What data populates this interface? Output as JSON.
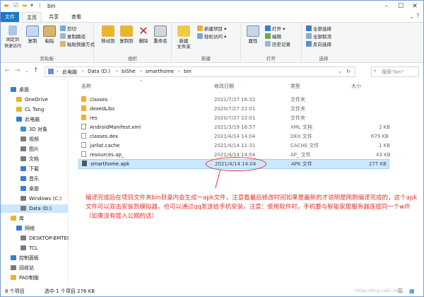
{
  "window": {
    "title": "bin"
  },
  "tabs": [
    "文件",
    "主页",
    "共享",
    "查看"
  ],
  "ribbon": {
    "clipboard": {
      "pin": "固定到\n快速访问",
      "copy": "复制",
      "paste": "粘贴",
      "cut": "剪切",
      "copy_path": "复制路径",
      "paste_shortcut": "粘贴快捷方式",
      "label": "剪贴板"
    },
    "organize": {
      "move_to": "移动到",
      "copy_to": "复制到",
      "delete": "删除",
      "rename": "重命名",
      "label": "组织"
    },
    "new": {
      "new_folder": "新建\n文件夹",
      "new_item": "新建项目",
      "easy_access": "轻松访问",
      "label": "新建"
    },
    "open": {
      "properties": "属性",
      "open": "打开",
      "edit": "编辑",
      "history": "历史记录",
      "label": "打开"
    },
    "select": {
      "select_all": "全部选择",
      "select_none": "全部取消",
      "invert": "反向选择",
      "label": "选择"
    }
  },
  "address": {
    "crumbs": [
      "此电脑",
      "Data (D:)",
      "biShe",
      "smarthome",
      "bin"
    ],
    "search_placeholder": "搜索\"bin\""
  },
  "nav": [
    {
      "label": "桌面",
      "color": "#3a7bd5"
    },
    {
      "label": "OneDrive",
      "color": "#e9b430"
    },
    {
      "label": "CL Tang",
      "color": "#e9b430"
    },
    {
      "label": "此电脑",
      "color": "#3a7bd5"
    },
    {
      "label": "3D 对象",
      "color": "#3a8fd5"
    },
    {
      "label": "视频",
      "color": "#7a7a7a"
    },
    {
      "label": "图片",
      "color": "#7a7a7a"
    },
    {
      "label": "文档",
      "color": "#7a7a7a"
    },
    {
      "label": "下载",
      "color": "#3a7bd5"
    },
    {
      "label": "音乐",
      "color": "#3a7bd5"
    },
    {
      "label": "桌面",
      "color": "#3a7bd5"
    },
    {
      "label": "Windows (C:)",
      "color": "#7a7a7a"
    },
    {
      "label": "Data (D:)",
      "color": "#7a7a7a"
    },
    {
      "label": "库",
      "color": "#e9b430"
    },
    {
      "label": "网络",
      "color": "#3a7bd5"
    },
    {
      "label": "DESKTOP-BMTEI",
      "color": "#7a7a7a"
    },
    {
      "label": "TCL",
      "color": "#7a7a7a"
    },
    {
      "label": "控制面板",
      "color": "#3a7bd5"
    },
    {
      "label": "回收站",
      "color": "#7a7a7a"
    },
    {
      "label": "PAD制版",
      "color": "#e9b430"
    }
  ],
  "columns": {
    "name": "名称",
    "date": "修改日期",
    "type": "类型",
    "size": "大小"
  },
  "files": [
    {
      "name": "classes",
      "date": "2021/7/27 16:32",
      "type": "文件夹",
      "size": "",
      "color": "#e9b430"
    },
    {
      "name": "dexedLibs",
      "date": "2020/7/27 22:01",
      "type": "文件夹",
      "size": "",
      "color": "#e9b430"
    },
    {
      "name": "res",
      "date": "2020/7/27 22:01",
      "type": "文件夹",
      "size": "",
      "color": "#e9b430"
    },
    {
      "name": "AndroidManifest.xml",
      "date": "2021/3/19 16:57",
      "type": "XML 文档",
      "size": "2 KB",
      "color": "#6aa84f"
    },
    {
      "name": "classes.dex",
      "date": "2021/4/14 14:04",
      "type": "DEX 文件",
      "size": "679 KB",
      "color": "#cccccc"
    },
    {
      "name": "jarlist.cache",
      "date": "2021/4/14 11:31",
      "type": "CACHE 文件",
      "size": "1 KB",
      "color": "#cccccc"
    },
    {
      "name": "resources.ap_",
      "date": "2021/4/14 14:04",
      "type": "AP_ 文件",
      "size": "43 KB",
      "color": "#cccccc"
    },
    {
      "name": "smarthome.apk",
      "date": "2021/4/14 14:04",
      "type": "APK 文件",
      "size": "277 KB",
      "color": "#555555"
    }
  ],
  "annotation": "编译完成后在项目文件夹bin目录内会生成一apk文件，注意看最后修改时间如果是最新的才说明是刚刚编译完成的，这个apk文件可以双击安装到模拟器，也可以通过qq发送给手机安装，注意：使用软件时，手机要与智能家居服务器连接同一个wifi（如果没有接入公网的话）",
  "status": {
    "count": "8 个项目",
    "selected": "选中 1 个项目 276 KB"
  },
  "watermark": "https://blog.csdn.net/..."
}
